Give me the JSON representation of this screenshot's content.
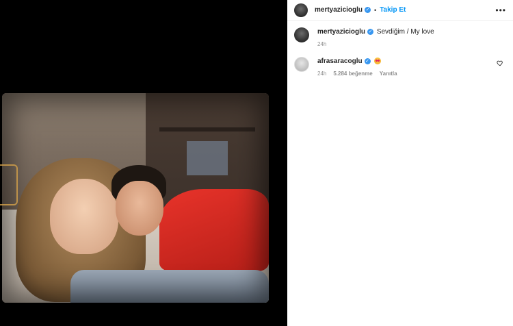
{
  "post": {
    "author": "mertyazicioglu",
    "follow_label": "Takip Et",
    "separator": "•",
    "more_label": "•••"
  },
  "caption": {
    "username": "mertyazicioglu",
    "text": "Sevdiğim / My love",
    "time": "24h"
  },
  "comments": [
    {
      "username": "afrasaracoglu",
      "emoji": "star-struck-emoji",
      "time": "24h",
      "likes": "5.284 beğenme",
      "reply_label": "Yanıtla"
    }
  ],
  "colors": {
    "accent": "#0095f6",
    "verified": "#3897f0",
    "muted": "#8e8e8e",
    "text": "#262626"
  }
}
